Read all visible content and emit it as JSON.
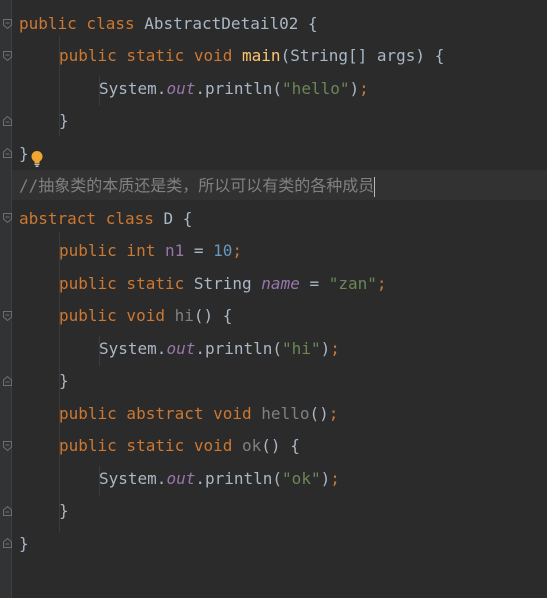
{
  "colors": {
    "background": "#2b2b2b",
    "keyword": "#cc7832",
    "method": "#ffc66d",
    "string": "#6a8759",
    "number": "#6897bb",
    "field": "#9876aa",
    "plain": "#a9b7c6",
    "comment": "#808080"
  },
  "code": {
    "l1": {
      "kw": "public class ",
      "name": "AbstractDetail02 {"
    },
    "l2": {
      "kw1": "public static void ",
      "fn": "main",
      "rest": "(String[] args) {"
    },
    "l3": {
      "a": "System.",
      "field": "out",
      "b": ".println(",
      "str": "\"hello\"",
      "c": ")",
      "semi": ";"
    },
    "l4": {
      "text": "}"
    },
    "l5": {
      "text": "}"
    },
    "l6": {
      "comment": "//抽象类的本质还是类，所以可以有类的各种成员"
    },
    "l7": {
      "kw": "abstract class ",
      "name": "D {"
    },
    "l8": {
      "kw": "public int ",
      "ivar": "n1",
      "eq": " = ",
      "num": "10",
      "semi": ";"
    },
    "l9": {
      "kw": "public static ",
      "type": "String ",
      "field": "name",
      "eq": " = ",
      "str": "\"zan\"",
      "semi": ";"
    },
    "l10": {
      "kw": "public void ",
      "fn": "hi",
      "rest": "() {"
    },
    "l11": {
      "a": "System.",
      "field": "out",
      "b": ".println(",
      "str": "\"hi\"",
      "c": ")",
      "semi": ";"
    },
    "l12": {
      "text": "}"
    },
    "l13": {
      "kw": "public abstract void ",
      "fn": "hello",
      "rest": "()",
      "semi": ";"
    },
    "l14": {
      "kw": "public static void ",
      "fn": "ok",
      "rest": "() {"
    },
    "l15": {
      "a": "System.",
      "field": "out",
      "b": ".println(",
      "str": "\"ok\"",
      "c": ")",
      "semi": ";"
    },
    "l16": {
      "text": "}"
    },
    "l17": {
      "text": "}"
    }
  },
  "icons": {
    "intention": "lightbulb-icon",
    "fold": "fold-marker-icon"
  }
}
